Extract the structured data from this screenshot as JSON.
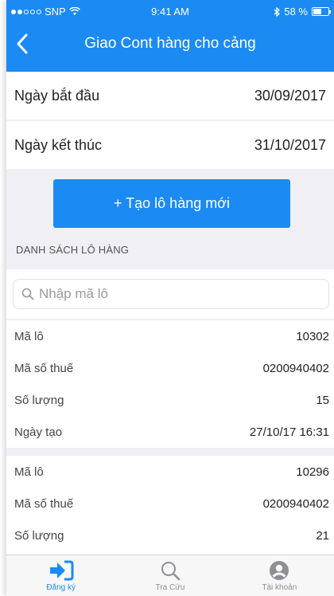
{
  "status_bar": {
    "carrier": "SNP",
    "time": "9:41 AM",
    "battery": "58 %",
    "battery_level": 0.58
  },
  "nav": {
    "title": "Giao Cont hàng cho cảng",
    "back_icon": "chevron-left-icon"
  },
  "filters": {
    "start_label": "Ngày bắt đầu",
    "start_value": "30/09/2017",
    "end_label": "Ngày kết thúc",
    "end_value": "31/10/2017"
  },
  "new_button_label": "+ Tạo lô hàng mới",
  "section_title": "DANH SÁCH LÔ HÀNG",
  "search": {
    "placeholder": "Nhập mã lô",
    "value": ""
  },
  "lots": [
    {
      "ma_lo_label": "Mã lô",
      "ma_lo": "10302",
      "ma_so_thue_label": "Mã số thuế",
      "ma_so_thue": "0200940402",
      "so_luong_label": "Số lượng",
      "so_luong": "15",
      "ngay_tao_label": "Ngày tạo",
      "ngay_tao": "27/10/17 16:31"
    },
    {
      "ma_lo_label": "Mã lô",
      "ma_lo": "10296",
      "ma_so_thue_label": "Mã số thuế",
      "ma_so_thue": "0200940402",
      "so_luong_label": "Số lượng",
      "so_luong": "21"
    }
  ],
  "tabs": [
    {
      "label": "Đăng ký",
      "icon": "sign-in-icon",
      "active": true
    },
    {
      "label": "Tra Cứu",
      "icon": "search-icon",
      "active": false
    },
    {
      "label": "Tài khoản",
      "icon": "user-icon",
      "active": false
    }
  ],
  "colors": {
    "primary": "#1b8af3",
    "background": "#efeff4",
    "tab_inactive": "#8e8e93"
  }
}
